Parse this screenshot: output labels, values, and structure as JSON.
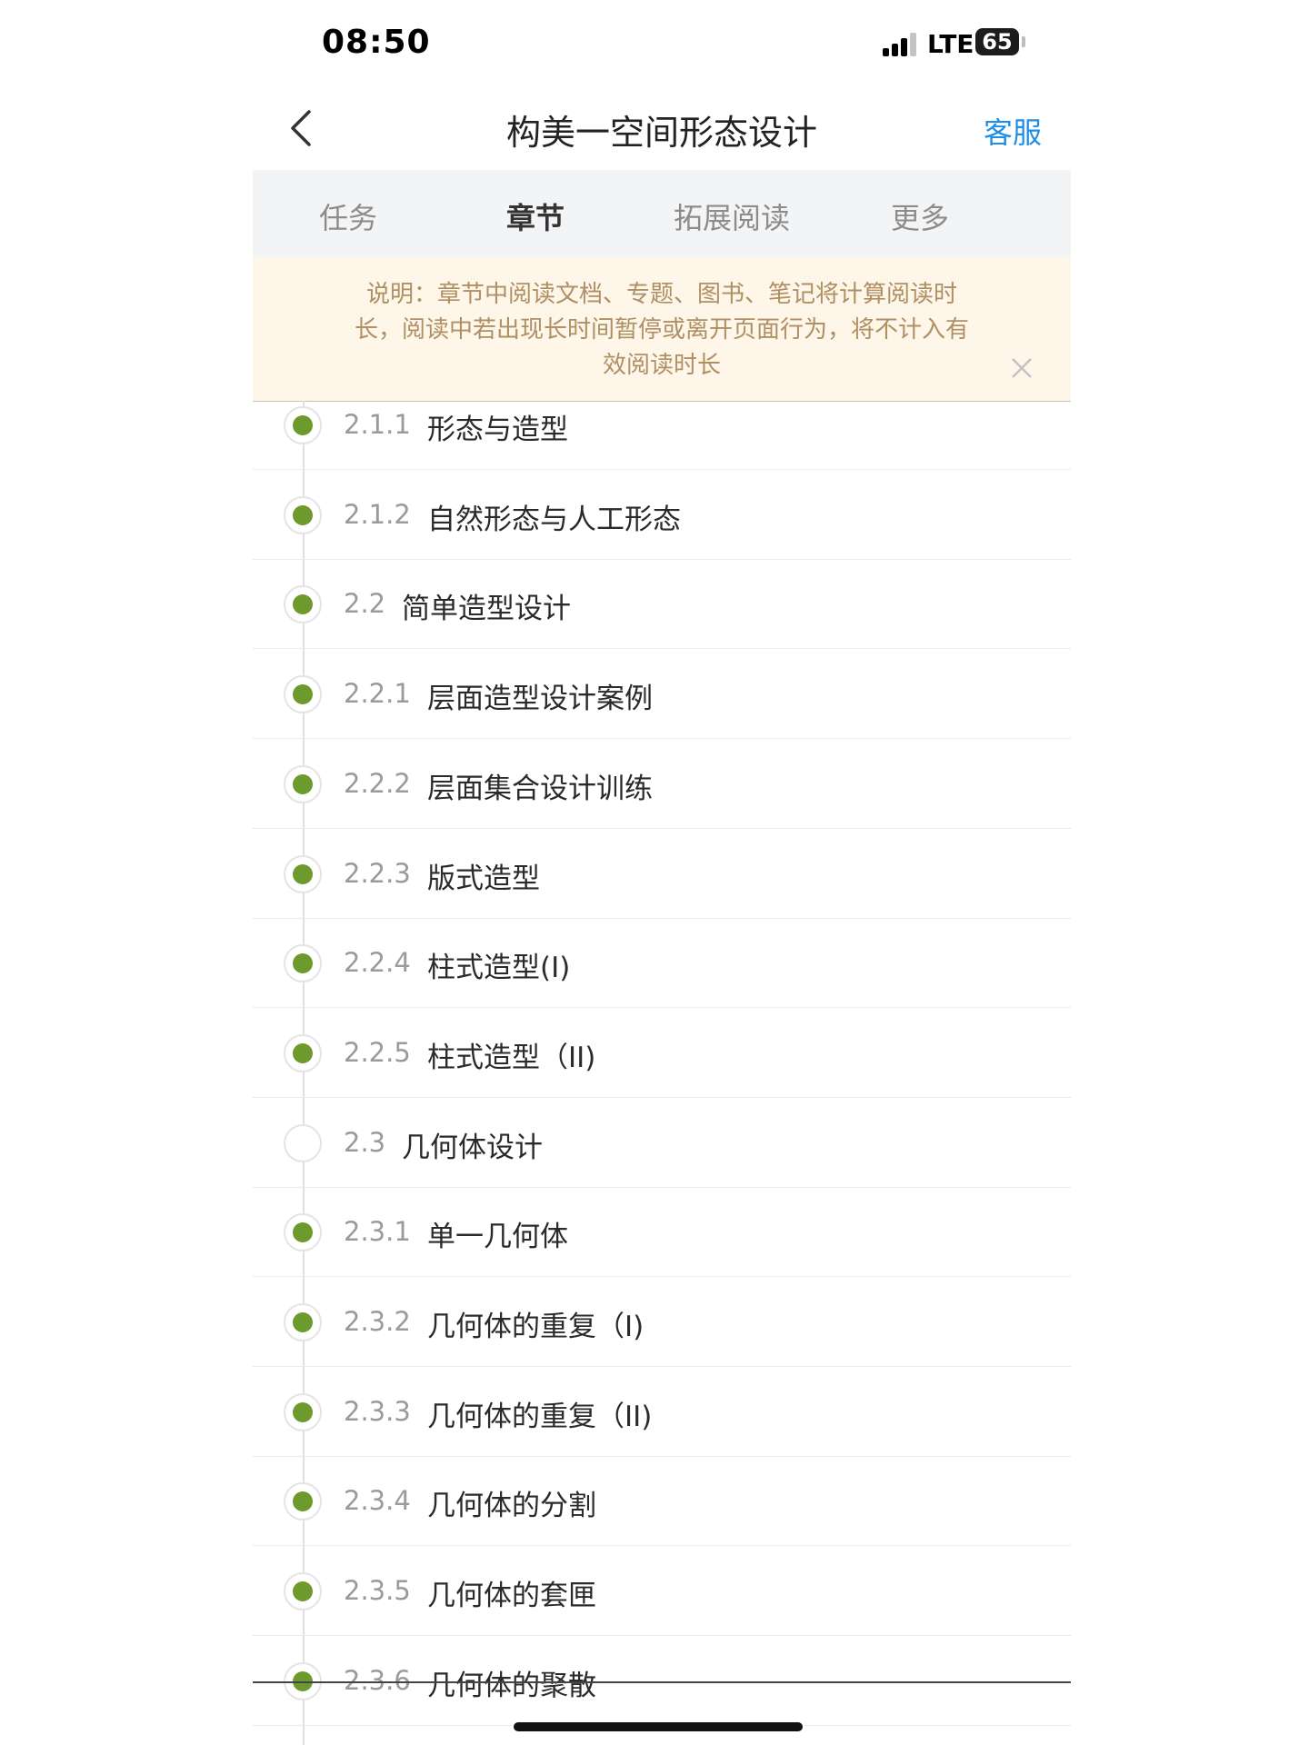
{
  "status_bar": {
    "time": "08:50",
    "network": "LTE",
    "battery": "65"
  },
  "nav": {
    "title": "构美一空间形态设计",
    "service_label": "客服"
  },
  "tabs": [
    {
      "label": "任务",
      "active": false
    },
    {
      "label": "章节",
      "active": true
    },
    {
      "label": "拓展阅读",
      "active": false
    },
    {
      "label": "更多",
      "active": false
    }
  ],
  "notice": {
    "text": "说明：章节中阅读文档、专题、图书、笔记将计算阅读时长，阅读中若出现长时间暂停或离开页面行为，将不计入有效阅读时长"
  },
  "chapters": [
    {
      "number": "2.1.1",
      "title": "形态与造型",
      "completed": true
    },
    {
      "number": "2.1.2",
      "title": "自然形态与人工形态",
      "completed": true
    },
    {
      "number": "2.2",
      "title": "简单造型设计",
      "completed": true
    },
    {
      "number": "2.2.1",
      "title": "层面造型设计案例",
      "completed": true
    },
    {
      "number": "2.2.2",
      "title": "层面集合设计训练",
      "completed": true
    },
    {
      "number": "2.2.3",
      "title": "版式造型",
      "completed": true
    },
    {
      "number": "2.2.4",
      "title": "柱式造型(I)",
      "completed": true
    },
    {
      "number": "2.2.5",
      "title": "柱式造型（II)",
      "completed": true
    },
    {
      "number": "2.3",
      "title": "几何体设计",
      "completed": false
    },
    {
      "number": "2.3.1",
      "title": "单一几何体",
      "completed": true
    },
    {
      "number": "2.3.2",
      "title": "几何体的重复（I)",
      "completed": true
    },
    {
      "number": "2.3.3",
      "title": "几何体的重复（II)",
      "completed": true
    },
    {
      "number": "2.3.4",
      "title": "几何体的分割",
      "completed": true
    },
    {
      "number": "2.3.5",
      "title": "几何体的套匣",
      "completed": true
    },
    {
      "number": "2.3.6",
      "title": "几何体的聚散",
      "completed": true
    }
  ],
  "colors": {
    "accent": "#1e8fe8",
    "completed_dot": "#6d9a2c",
    "notice_text": "#b08f62",
    "notice_bg": "#fdf6e9"
  },
  "icons": {
    "back": "chevron-left-icon",
    "close": "close-icon",
    "signal": "signal-icon",
    "battery": "battery-icon"
  }
}
